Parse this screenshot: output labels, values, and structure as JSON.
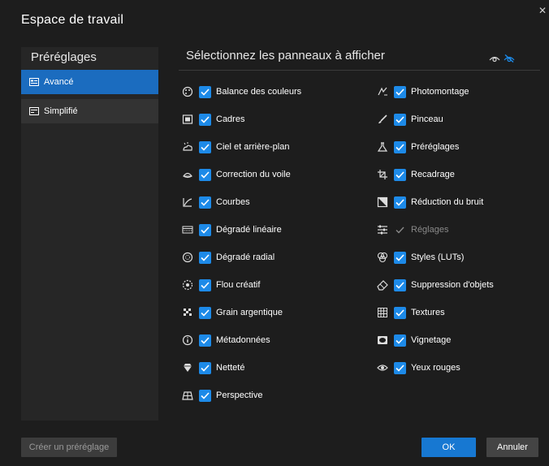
{
  "dialog": {
    "title": "Espace de travail"
  },
  "sidebar": {
    "header": "Préréglages",
    "items": [
      {
        "label": "Avancé",
        "icon": "advanced-layout-icon",
        "active": true
      },
      {
        "label": "Simplifié",
        "icon": "simple-layout-icon",
        "active": false
      }
    ]
  },
  "main": {
    "title": "Sélectionnez les panneaux à afficher",
    "icons": [
      "show-all-eye-icon",
      "hide-all-eye-icon"
    ]
  },
  "panels": {
    "left": [
      {
        "label": "Balance des couleurs",
        "icon": "color-balance-icon",
        "checked": true
      },
      {
        "label": "Cadres",
        "icon": "frames-icon",
        "checked": true
      },
      {
        "label": "Ciel et arrière-plan",
        "icon": "sky-icon",
        "checked": true
      },
      {
        "label": "Correction du voile",
        "icon": "haze-icon",
        "checked": true
      },
      {
        "label": "Courbes",
        "icon": "curves-icon",
        "checked": true
      },
      {
        "label": "Dégradé linéaire",
        "icon": "linear-gradient-icon",
        "checked": true
      },
      {
        "label": "Dégradé radial",
        "icon": "radial-gradient-icon",
        "checked": true
      },
      {
        "label": "Flou créatif",
        "icon": "creative-blur-icon",
        "checked": true
      },
      {
        "label": "Grain argentique",
        "icon": "film-grain-icon",
        "checked": true
      },
      {
        "label": "Métadonnées",
        "icon": "metadata-icon",
        "checked": true
      },
      {
        "label": "Netteté",
        "icon": "sharpen-icon",
        "checked": true
      },
      {
        "label": "Perspective",
        "icon": "perspective-icon",
        "checked": true
      }
    ],
    "right": [
      {
        "label": "Photomontage",
        "icon": "photomontage-icon",
        "checked": true
      },
      {
        "label": "Pinceau",
        "icon": "brush-icon",
        "checked": true
      },
      {
        "label": "Préréglages",
        "icon": "presets-icon",
        "checked": true
      },
      {
        "label": "Recadrage",
        "icon": "crop-icon",
        "checked": true
      },
      {
        "label": "Réduction du bruit",
        "icon": "noise-reduction-icon",
        "checked": true
      },
      {
        "label": "Réglages",
        "icon": "adjustments-icon",
        "checked": true,
        "disabled": true
      },
      {
        "label": "Styles (LUTs)",
        "icon": "styles-icon",
        "checked": true
      },
      {
        "label": "Suppression d'objets",
        "icon": "eraser-icon",
        "checked": true
      },
      {
        "label": "Textures",
        "icon": "textures-icon",
        "checked": true
      },
      {
        "label": "Vignetage",
        "icon": "vignette-icon",
        "checked": true
      },
      {
        "label": "Yeux rouges",
        "icon": "red-eye-icon",
        "checked": true
      }
    ]
  },
  "footer": {
    "create_preset": "Créer un préréglage",
    "ok": "OK",
    "cancel": "Annuler"
  },
  "colors": {
    "background": "#1d1d1d",
    "sidebar": "#262626",
    "accent": "#1b6cbf",
    "checkbox": "#1d8ae8"
  }
}
